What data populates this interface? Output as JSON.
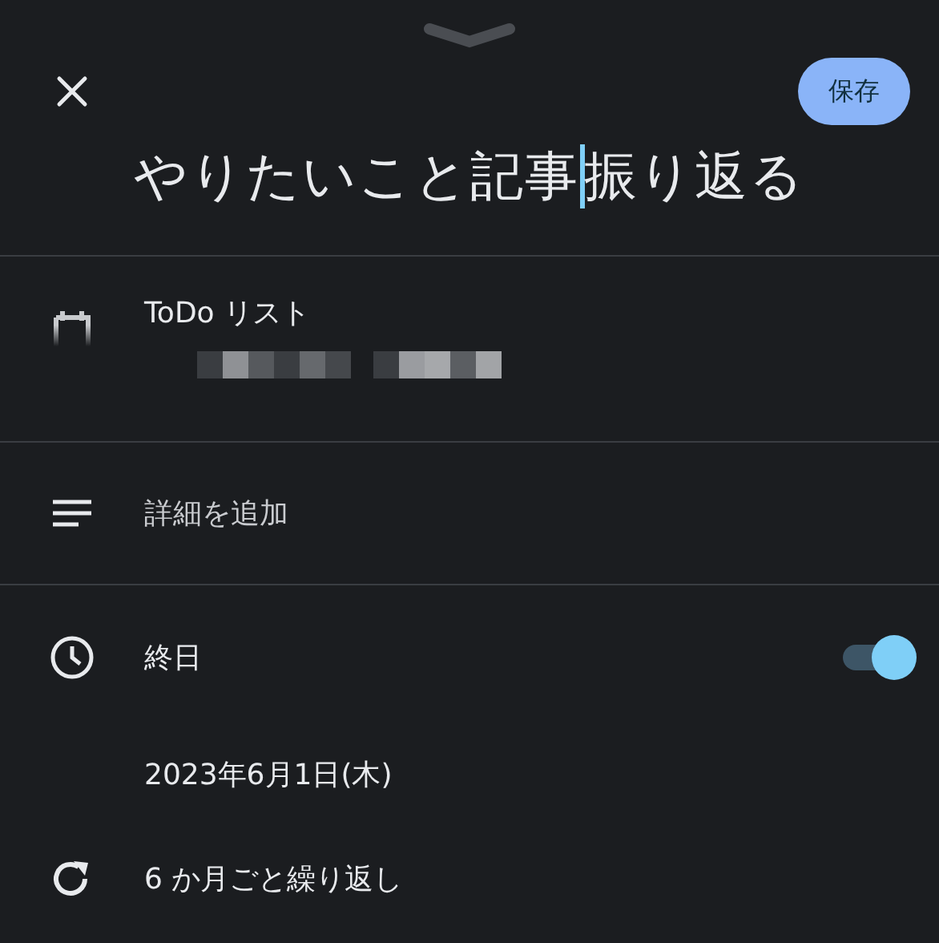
{
  "header": {
    "save_button": "保存"
  },
  "title_field": {
    "text_before_cursor": "やりたいこと記事",
    "text_after_cursor": "振り返る"
  },
  "list_row": {
    "label": "ToDo リスト"
  },
  "details_row": {
    "placeholder": "詳細を追加"
  },
  "all_day_row": {
    "label": "終日",
    "on": true
  },
  "date_row": {
    "date": "2023年6月1日(木)"
  },
  "repeat_row": {
    "label": "6 か月ごと繰り返し"
  }
}
